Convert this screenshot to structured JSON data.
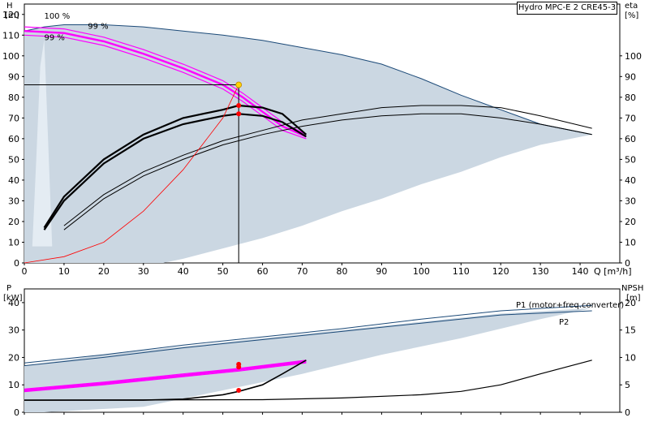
{
  "title": "Hydro MPC-E 2 CRE45-3",
  "colors": {
    "envelope_fill": "#cbd7e2",
    "envelope_edge": "#1c4a78",
    "magenta": "#ff00ff",
    "operating_point": "#ff0000",
    "system_curve": "#ff0000",
    "duty_marker": "#ffd700",
    "curve": "#000000"
  },
  "chart_data": [
    {
      "id": "head",
      "type": "line",
      "x_axis": {
        "label": "Q [m³/h]",
        "range": [
          0,
          150
        ],
        "ticks": [
          0,
          10,
          20,
          30,
          40,
          50,
          60,
          70,
          80,
          90,
          100,
          110,
          120,
          130,
          140
        ]
      },
      "y_left": {
        "unit": "[m]",
        "name": "H",
        "range": [
          0,
          125
        ],
        "ticks": [
          0,
          10,
          20,
          30,
          40,
          50,
          60,
          70,
          80,
          90,
          100,
          110,
          120
        ]
      },
      "y_right": {
        "unit": "[%]",
        "name": "eta",
        "range": [
          0,
          125
        ],
        "ticks": [
          0,
          10,
          20,
          30,
          40,
          50,
          60,
          70,
          80,
          90,
          100
        ]
      },
      "annotations": [
        "100 %",
        "99 %",
        "99 %"
      ],
      "envelope": {
        "upper": [
          [
            0,
            112
          ],
          [
            5,
            114
          ],
          [
            10,
            115
          ],
          [
            20,
            115
          ],
          [
            30,
            114
          ],
          [
            40,
            112
          ],
          [
            50,
            110
          ],
          [
            60,
            107.5
          ],
          [
            70,
            104
          ],
          [
            80,
            100.5
          ],
          [
            90,
            96
          ],
          [
            100,
            89
          ],
          [
            110,
            81
          ],
          [
            120,
            74
          ],
          [
            130,
            67
          ],
          [
            143,
            62
          ]
        ],
        "lower": [
          [
            143,
            62
          ],
          [
            130,
            57
          ],
          [
            120,
            51
          ],
          [
            110,
            44
          ],
          [
            100,
            38
          ],
          [
            90,
            31
          ],
          [
            80,
            25
          ],
          [
            70,
            18
          ],
          [
            60,
            12
          ],
          [
            50,
            7
          ],
          [
            40,
            2
          ],
          [
            35,
            0
          ],
          [
            0,
            0
          ],
          [
            0,
            110
          ]
        ],
        "inner_light": [
          [
            2,
            8
          ],
          [
            3,
            50
          ],
          [
            4,
            95
          ],
          [
            5,
            108
          ],
          [
            7,
            8
          ]
        ]
      },
      "series": [
        {
          "key": "qh_100",
          "color": "#ff00ff",
          "points": [
            [
              0,
              114
            ],
            [
              10,
              113
            ],
            [
              20,
              109
            ],
            [
              30,
              103
            ],
            [
              40,
              96
            ],
            [
              50,
              88
            ],
            [
              55,
              82
            ],
            [
              60,
              75
            ],
            [
              65,
              68
            ],
            [
              71,
              62
            ]
          ]
        },
        {
          "key": "qh_99",
          "color": "#ff00ff",
          "points": [
            [
              0,
              112
            ],
            [
              10,
              111
            ],
            [
              20,
              107
            ],
            [
              30,
              101
            ],
            [
              40,
              94
            ],
            [
              50,
              86
            ],
            [
              55,
              80
            ],
            [
              60,
              73
            ],
            [
              65,
              66
            ],
            [
              71,
              61
            ]
          ]
        },
        {
          "key": "qh_98",
          "color": "#ff00ff",
          "points": [
            [
              0,
              110
            ],
            [
              10,
              109
            ],
            [
              20,
              105
            ],
            [
              30,
              99
            ],
            [
              40,
              92
            ],
            [
              50,
              84
            ],
            [
              55,
              78
            ],
            [
              60,
              71
            ],
            [
              65,
              64
            ],
            [
              71,
              60
            ]
          ]
        },
        {
          "key": "eta_pump_a",
          "color": "#000000",
          "points": [
            [
              5,
              17
            ],
            [
              10,
              32
            ],
            [
              20,
              50
            ],
            [
              30,
              62
            ],
            [
              40,
              70
            ],
            [
              50,
              74
            ],
            [
              54,
              76
            ],
            [
              60,
              75
            ],
            [
              65,
              72
            ],
            [
              71,
              62
            ]
          ]
        },
        {
          "key": "eta_pump_b",
          "color": "#000000",
          "points": [
            [
              5,
              16
            ],
            [
              10,
              30
            ],
            [
              20,
              48
            ],
            [
              30,
              60
            ],
            [
              40,
              67
            ],
            [
              50,
              71
            ],
            [
              54,
              72
            ],
            [
              60,
              71
            ],
            [
              65,
              68
            ],
            [
              71,
              61
            ]
          ]
        },
        {
          "key": "eta_total_a",
          "color": "#000000",
          "points": [
            [
              10,
              18
            ],
            [
              20,
              33
            ],
            [
              30,
              44
            ],
            [
              40,
              52
            ],
            [
              50,
              59
            ],
            [
              60,
              64
            ],
            [
              70,
              69
            ],
            [
              80,
              72
            ],
            [
              90,
              75
            ],
            [
              100,
              76
            ],
            [
              110,
              76
            ],
            [
              120,
              75
            ],
            [
              130,
              71
            ],
            [
              143,
              65
            ]
          ]
        },
        {
          "key": "eta_total_b",
          "color": "#000000",
          "points": [
            [
              10,
              16
            ],
            [
              20,
              31
            ],
            [
              30,
              42
            ],
            [
              40,
              50
            ],
            [
              50,
              57
            ],
            [
              60,
              62
            ],
            [
              70,
              66
            ],
            [
              80,
              69
            ],
            [
              90,
              71
            ],
            [
              100,
              72
            ],
            [
              110,
              72
            ],
            [
              120,
              70
            ],
            [
              130,
              67
            ],
            [
              143,
              62
            ]
          ]
        },
        {
          "key": "system_curve",
          "color": "#ff0000",
          "points": [
            [
              0,
              0
            ],
            [
              10,
              3
            ],
            [
              20,
              10
            ],
            [
              30,
              25
            ],
            [
              40,
              45
            ],
            [
              50,
              70
            ],
            [
              54,
              86
            ]
          ]
        }
      ],
      "duty_point": {
        "q": 54,
        "h": 86
      },
      "operating_points": [
        [
          54,
          76
        ],
        [
          54,
          72
        ]
      ]
    },
    {
      "id": "power",
      "type": "line",
      "x_axis": {
        "range": [
          0,
          150
        ]
      },
      "y_left": {
        "unit": "[kW]",
        "name": "P",
        "range": [
          0,
          45
        ],
        "ticks": [
          0,
          10,
          20,
          30,
          40
        ]
      },
      "y_right": {
        "unit": "[m]",
        "name": "NPSH",
        "range": [
          0,
          22.5
        ],
        "ticks": [
          0,
          5,
          10,
          15,
          20
        ]
      },
      "legend": [
        "P1 (motor+freq.converter)",
        "P2"
      ],
      "envelope": {
        "upper": [
          [
            0,
            17
          ],
          [
            10,
            19
          ],
          [
            20,
            21
          ],
          [
            40,
            24
          ],
          [
            60,
            27
          ],
          [
            80,
            30
          ],
          [
            100,
            33
          ],
          [
            120,
            36
          ],
          [
            143,
            38
          ]
        ],
        "lower": [
          [
            143,
            38
          ],
          [
            130,
            34
          ],
          [
            110,
            27
          ],
          [
            90,
            21
          ],
          [
            70,
            14
          ],
          [
            50,
            8
          ],
          [
            30,
            2
          ],
          [
            5,
            0
          ],
          [
            0,
            0
          ]
        ]
      },
      "series": [
        {
          "key": "p1_total",
          "color": "#1c4a78",
          "points": [
            [
              0,
              18
            ],
            [
              20,
              21
            ],
            [
              40,
              24.5
            ],
            [
              60,
              27.5
            ],
            [
              80,
              30.5
            ],
            [
              100,
              34
            ],
            [
              120,
              37
            ],
            [
              143,
              39
            ]
          ]
        },
        {
          "key": "p2_total",
          "color": "#1c4a78",
          "points": [
            [
              0,
              17
            ],
            [
              20,
              20
            ],
            [
              40,
              23.5
            ],
            [
              60,
              26.5
            ],
            [
              80,
              29.5
            ],
            [
              100,
              32.5
            ],
            [
              120,
              35.5
            ],
            [
              143,
              37
            ]
          ]
        },
        {
          "key": "p1_pump_a",
          "color": "#ff00ff",
          "points": [
            [
              0,
              8.5
            ],
            [
              20,
              11
            ],
            [
              40,
              14
            ],
            [
              54,
              16
            ],
            [
              71,
              19
            ]
          ]
        },
        {
          "key": "p1_pump_b",
          "color": "#ff00ff",
          "points": [
            [
              0,
              8
            ],
            [
              20,
              10.5
            ],
            [
              40,
              13.5
            ],
            [
              54,
              15.5
            ],
            [
              71,
              18.5
            ]
          ]
        },
        {
          "key": "p2_pump_a",
          "color": "#ff00ff",
          "points": [
            [
              0,
              7.5
            ],
            [
              20,
              10
            ],
            [
              40,
              13
            ],
            [
              54,
              15
            ],
            [
              71,
              18
            ]
          ]
        },
        {
          "key": "npsh_pump",
          "color": "#000000",
          "points": [
            [
              0,
              2.2
            ],
            [
              30,
              2.2
            ],
            [
              40,
              2.4
            ],
            [
              50,
              3.2
            ],
            [
              54,
              3.8
            ],
            [
              60,
              5
            ],
            [
              65,
              7
            ],
            [
              71,
              9.5
            ]
          ]
        },
        {
          "key": "npsh_system",
          "color": "#000000",
          "points": [
            [
              0,
              2.2
            ],
            [
              60,
              2.3
            ],
            [
              80,
              2.6
            ],
            [
              100,
              3.2
            ],
            [
              110,
              3.8
            ],
            [
              120,
              5
            ],
            [
              130,
              7
            ],
            [
              143,
              9.5
            ]
          ]
        }
      ],
      "operating_points": [
        [
          54,
          17.5
        ],
        [
          54,
          16.5
        ],
        [
          54,
          8
        ]
      ]
    }
  ]
}
